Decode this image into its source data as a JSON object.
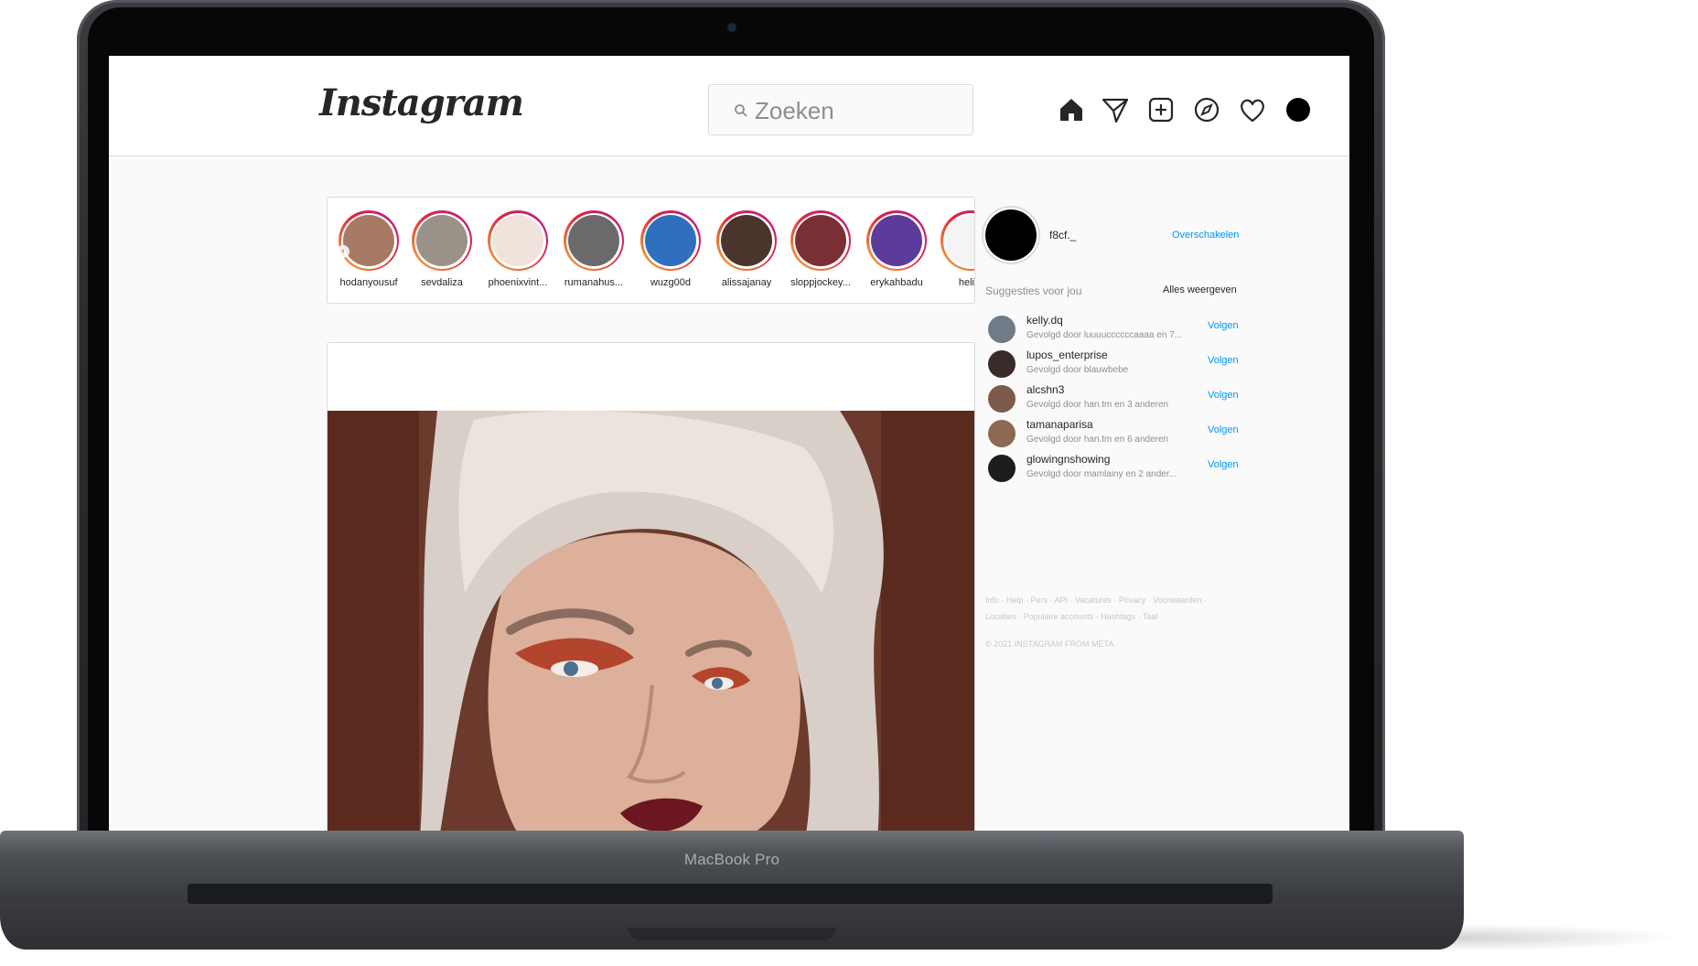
{
  "device": {
    "label": "MacBook Pro"
  },
  "header": {
    "logo": "Instagram",
    "search": {
      "placeholder": "Zoeken",
      "icon": "search-icon"
    },
    "nav_icons": [
      "home-icon",
      "direct-message-icon",
      "new-post-icon",
      "explore-icon",
      "activity-heart-icon",
      "profile-avatar-icon"
    ]
  },
  "stories": [
    {
      "username": "hodanyousuf",
      "color": "#a77a66"
    },
    {
      "username": "sevdaliza",
      "color": "#9a9189"
    },
    {
      "username": "phoenixvint...",
      "color": "#efe3dc"
    },
    {
      "username": "rumanahus...",
      "color": "#6a6a6a"
    },
    {
      "username": "wuzg00d",
      "color": "#2f6fbe"
    },
    {
      "username": "alissajanay",
      "color": "#4a342c"
    },
    {
      "username": "sloppjockey...",
      "color": "#7a2f34"
    },
    {
      "username": "erykahbadu",
      "color": "#5b3c9a"
    },
    {
      "username": "heliot",
      "color": "#f4f4f4"
    }
  ],
  "profile": {
    "username": "f8cf._",
    "switch_label": "Overschakelen"
  },
  "suggestions": {
    "title": "Suggesties voor jou",
    "see_all": "Alles weergeven",
    "follow_label": "Volgen",
    "items": [
      {
        "username": "kelly.dq",
        "subtitle": "Gevolgd door luuuuccccccaaaa en 7...",
        "color": "#6f7b86"
      },
      {
        "username": "lupos_enterprise",
        "subtitle": "Gevolgd door blauwbebe",
        "color": "#3a2a2a"
      },
      {
        "username": "alcshn3",
        "subtitle": "Gevolgd door han.tm en 3 anderen",
        "color": "#7d5a4b"
      },
      {
        "username": "tamanaparisa",
        "subtitle": "Gevolgd door han.tm en 6 anderen",
        "color": "#8c6a52"
      },
      {
        "username": "glowingnshowing",
        "subtitle": "Gevolgd door mamlainy en 2 ander...",
        "color": "#1d1d1d"
      }
    ]
  },
  "footer": {
    "links_line1": "Info · Help · Pers · API · Vacatures · Privacy · Voorwaarden ·",
    "links_line2": "Locaties · Populaire accounts · Hashtags · Taal",
    "copyright": "© 2021 INSTAGRAM FROM META"
  },
  "colors": {
    "accent": "#0095f6",
    "story_ring_start": "#f8b13a",
    "story_ring_end": "#bc1888",
    "post_background": "#5a2a1f"
  }
}
